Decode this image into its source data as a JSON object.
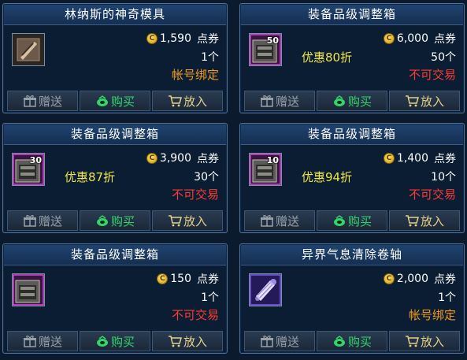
{
  "colors": {
    "account_bound": "#f39b1c",
    "not_tradable": "#ff3b32",
    "discount": "#f0e64a",
    "buy_green": "#35d46a",
    "gift_gray": "#9aa0a8",
    "put_gold": "#e7d08a"
  },
  "buttons": {
    "gift": "赠送",
    "buy": "购买",
    "put": "放入"
  },
  "cards": [
    {
      "title": "林纳斯的神奇模具",
      "icon": "mold-icon",
      "price": "1,590",
      "unit": "点券",
      "count": "1个",
      "trade": "帐号绑定",
      "trade_type": "account_bound",
      "discount": "",
      "badge": ""
    },
    {
      "title": "装备品级调整箱",
      "icon": "chest-icon",
      "price": "6,000",
      "unit": "点券",
      "count": "50个",
      "trade": "不可交易",
      "trade_type": "not_tradable",
      "discount": "优惠80折",
      "badge": "50"
    },
    {
      "title": "装备品级调整箱",
      "icon": "chest-icon",
      "price": "3,900",
      "unit": "点券",
      "count": "30个",
      "trade": "不可交易",
      "trade_type": "not_tradable",
      "discount": "优惠87折",
      "badge": "30"
    },
    {
      "title": "装备品级调整箱",
      "icon": "chest-icon",
      "price": "1,400",
      "unit": "点券",
      "count": "10个",
      "trade": "不可交易",
      "trade_type": "not_tradable",
      "discount": "优惠94折",
      "badge": "10"
    },
    {
      "title": "装备品级调整箱",
      "icon": "chest-icon",
      "price": "150",
      "unit": "点券",
      "count": "1个",
      "trade": "不可交易",
      "trade_type": "not_tradable",
      "discount": "",
      "badge": ""
    },
    {
      "title": "异界气息清除卷轴",
      "icon": "scroll-icon",
      "price": "2,000",
      "unit": "点券",
      "count": "1个",
      "trade": "帐号绑定",
      "trade_type": "account_bound",
      "discount": "",
      "badge": ""
    }
  ]
}
